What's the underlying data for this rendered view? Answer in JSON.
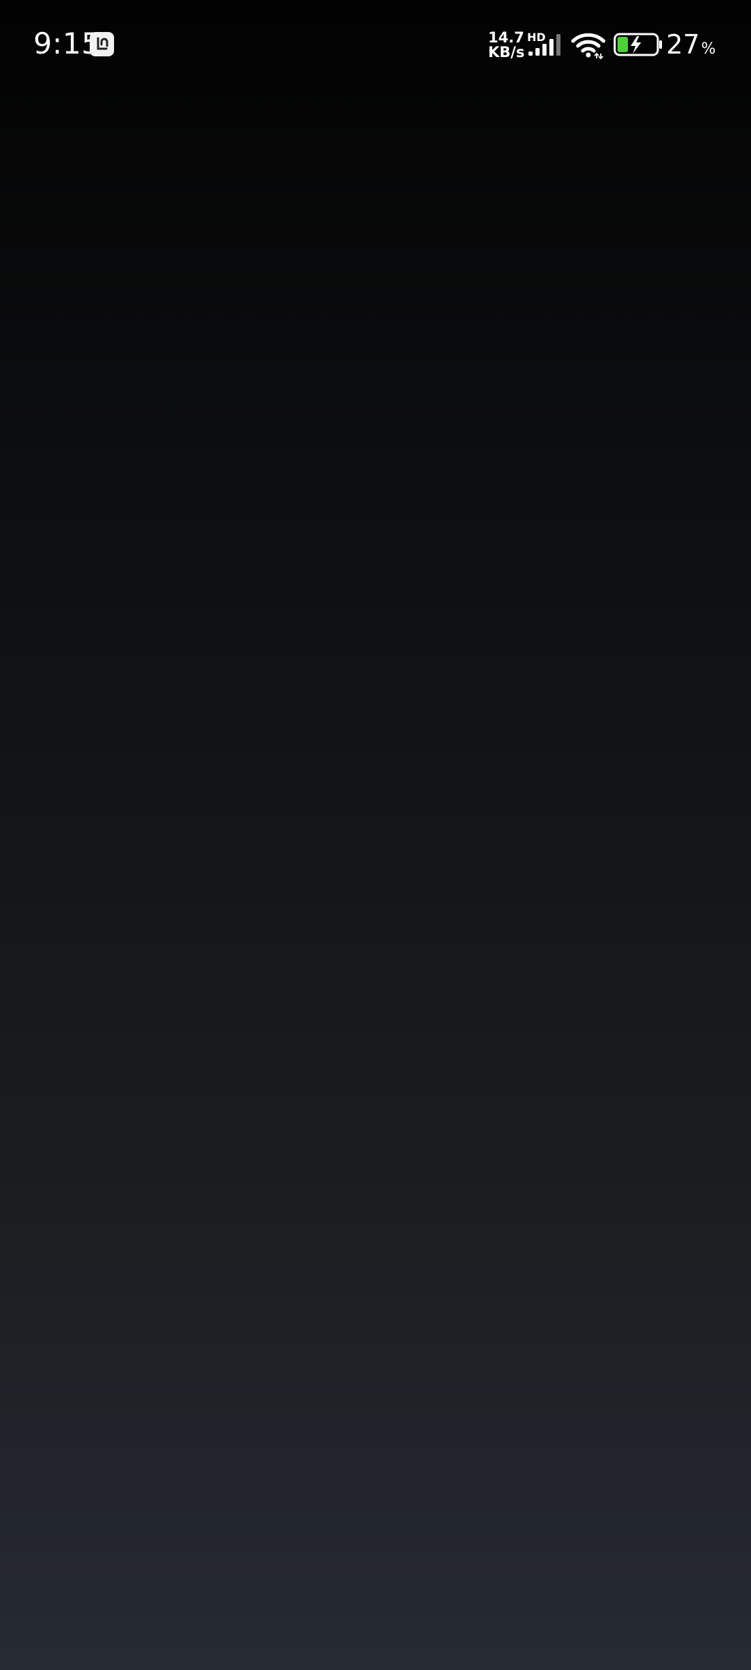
{
  "status_bar": {
    "time": "9:15",
    "app_badge_icon": "app-notification-icon",
    "net_speed_value": "14.7",
    "net_speed_unit": "KB/s",
    "network_type": "HD",
    "signal_icon": "cellular-signal-icon",
    "wifi_icon": "wifi-icon",
    "battery_icon": "battery-charging-icon",
    "battery_level": "27",
    "battery_unit": "%",
    "battery_fill_fraction": 0.27,
    "battery_color": "#4cd137"
  },
  "screen": {
    "background_top": "#020202",
    "background_bottom": "#262a33"
  }
}
